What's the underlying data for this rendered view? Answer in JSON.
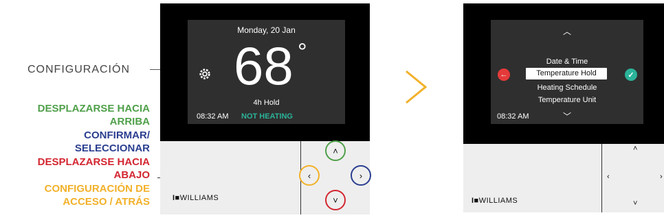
{
  "annotations": {
    "settings_label": "CONFIGURACIÓN",
    "scroll_up": "DESPLAZARSE HACIA ARRIBA",
    "confirm": "CONFIRMAR/ SELECCIONAR",
    "scroll_down": "DESPLAZARSE HACIA ABAJO",
    "access_settings": "CONFIGURACIÓN DE ACCESO / ATRÁS"
  },
  "colors": {
    "green": "#4fa04a",
    "blue": "#2b3f8f",
    "red": "#d32630",
    "orange": "#f2b12a",
    "teal": "#2bb39a"
  },
  "home_screen": {
    "date": "Monday, 20 Jan",
    "temperature": "68",
    "degree": "°",
    "hold": "4h Hold",
    "time": "08:32 AM",
    "status": "NOT HEATING",
    "settings_icon": "gear-icon"
  },
  "brand": "WILLIAMS",
  "nav_buttons": {
    "up": "˄",
    "left": "‹",
    "right": "›",
    "down": "˅"
  },
  "separator": ">",
  "menu_screen": {
    "up_arrow": "︿",
    "down_arrow": "﹀",
    "items": [
      "Date & Time",
      "Temperature Hold",
      "Heating Schedule",
      "Temperature Unit"
    ],
    "selected": "Temperature Hold",
    "time": "08:32 AM",
    "back_icon": "←",
    "confirm_icon": "✓"
  }
}
